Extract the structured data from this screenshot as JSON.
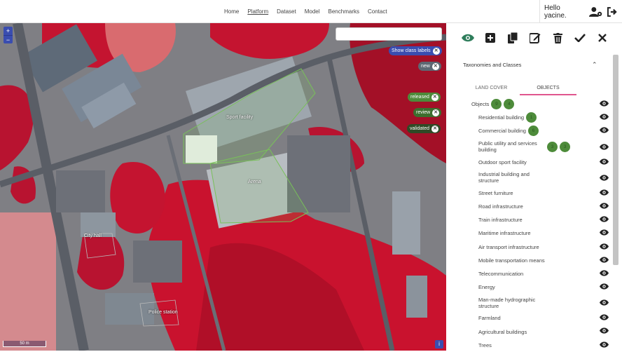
{
  "nav": {
    "items": [
      "Home",
      "Platform",
      "Dataset",
      "Model",
      "Benchmarks",
      "Contact"
    ],
    "active": "Platform"
  },
  "user": {
    "greeting": "Hello yacine."
  },
  "map": {
    "zoom_in": "+",
    "zoom_out": "−",
    "search_value": "",
    "pills": [
      {
        "label": "Show class labels",
        "color": "#3a4db0"
      },
      {
        "label": "new",
        "color": "#5d6873"
      },
      {
        "label": "released",
        "color": "#4d8b3a"
      },
      {
        "label": "review",
        "color": "#3d6e2e"
      },
      {
        "label": "validated",
        "color": "#2f4a26"
      }
    ],
    "labels": [
      "Sport facility",
      "Arena",
      "City hall",
      "Police station"
    ],
    "scale": "50 m",
    "info": "i"
  },
  "panel": {
    "section_title": "Taxonomies and Classes",
    "tabs": [
      "LAND COVER",
      "OBJECTS"
    ],
    "active_tab": "OBJECTS",
    "root": {
      "label": "Objects",
      "badges": [
        "9",
        "4"
      ]
    },
    "classes": [
      {
        "label": "Residential building",
        "badges": [
          "1"
        ]
      },
      {
        "label": "Commercial building",
        "badges": [
          "6"
        ]
      },
      {
        "label": "Public utility and services building",
        "badges": [
          "3",
          "3"
        ]
      },
      {
        "label": "Outdoor sport facility",
        "badges": []
      },
      {
        "label": "Industrial building and structure",
        "badges": []
      },
      {
        "label": "Street furniture",
        "badges": []
      },
      {
        "label": "Road infrastructure",
        "badges": []
      },
      {
        "label": "Train infrastructure",
        "badges": []
      },
      {
        "label": "Maritime infrastructure",
        "badges": []
      },
      {
        "label": "Air transport infrastructure",
        "badges": []
      },
      {
        "label": "Mobile transportation means",
        "badges": []
      },
      {
        "label": "Telecommunication",
        "badges": []
      },
      {
        "label": "Energy",
        "badges": []
      },
      {
        "label": "Man-made hydrographic structure",
        "badges": []
      },
      {
        "label": "Farmland",
        "badges": []
      },
      {
        "label": "Agricultural buildings",
        "badges": []
      },
      {
        "label": "Trees",
        "badges": []
      }
    ]
  },
  "colors": {
    "accent": "#3a4db0",
    "tab_underline": "#e0568e",
    "badge": "#4d8b3a",
    "eye_active": "#2e7d5b"
  }
}
